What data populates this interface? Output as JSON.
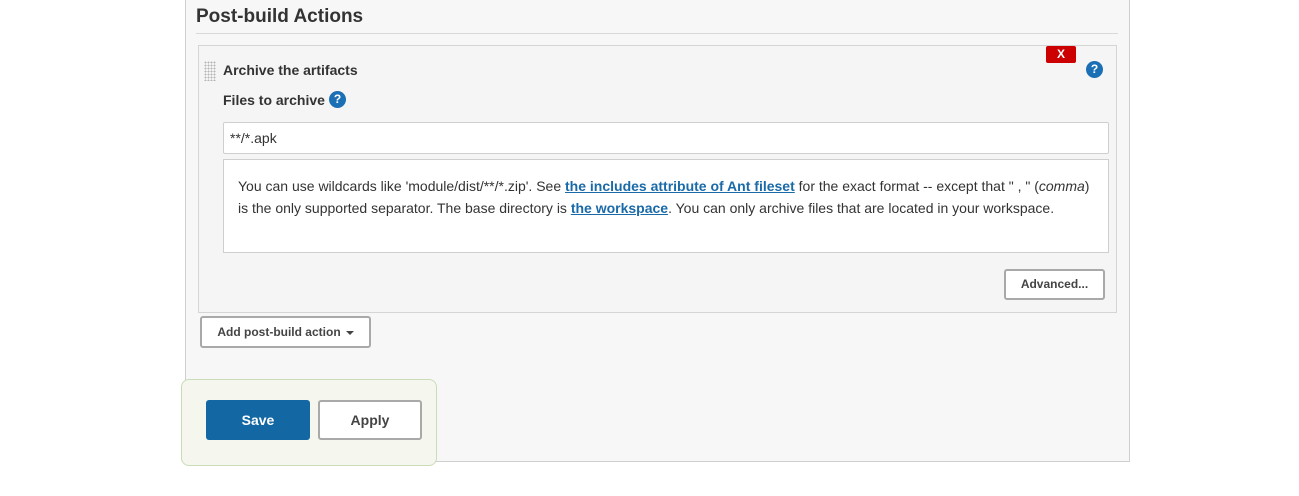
{
  "section": {
    "title": "Post-build Actions"
  },
  "step": {
    "title": "Archive the artifacts",
    "delete_label": "X",
    "help_icon": "?"
  },
  "field": {
    "label": "Files to archive",
    "help_icon": "?",
    "value": "**/*.apk",
    "help": {
      "part1": "You can use wildcards like 'module/dist/**/*.zip'. See ",
      "link1": "the includes attribute of Ant fileset",
      "part2": " for the exact format -- except that \" , \" (",
      "em": "comma",
      "part3": ") is the only supported separator. The base directory is ",
      "link2": "the workspace",
      "part4": ". You can only archive files that are located in your workspace."
    }
  },
  "buttons": {
    "advanced": "Advanced...",
    "add_post_build_action": "Add post-build action",
    "save": "Save",
    "apply": "Apply"
  },
  "colors": {
    "primary": "#1367a3",
    "danger": "#cc0000",
    "link": "#1a6aa8",
    "help_icon": "#1b6fb5"
  }
}
